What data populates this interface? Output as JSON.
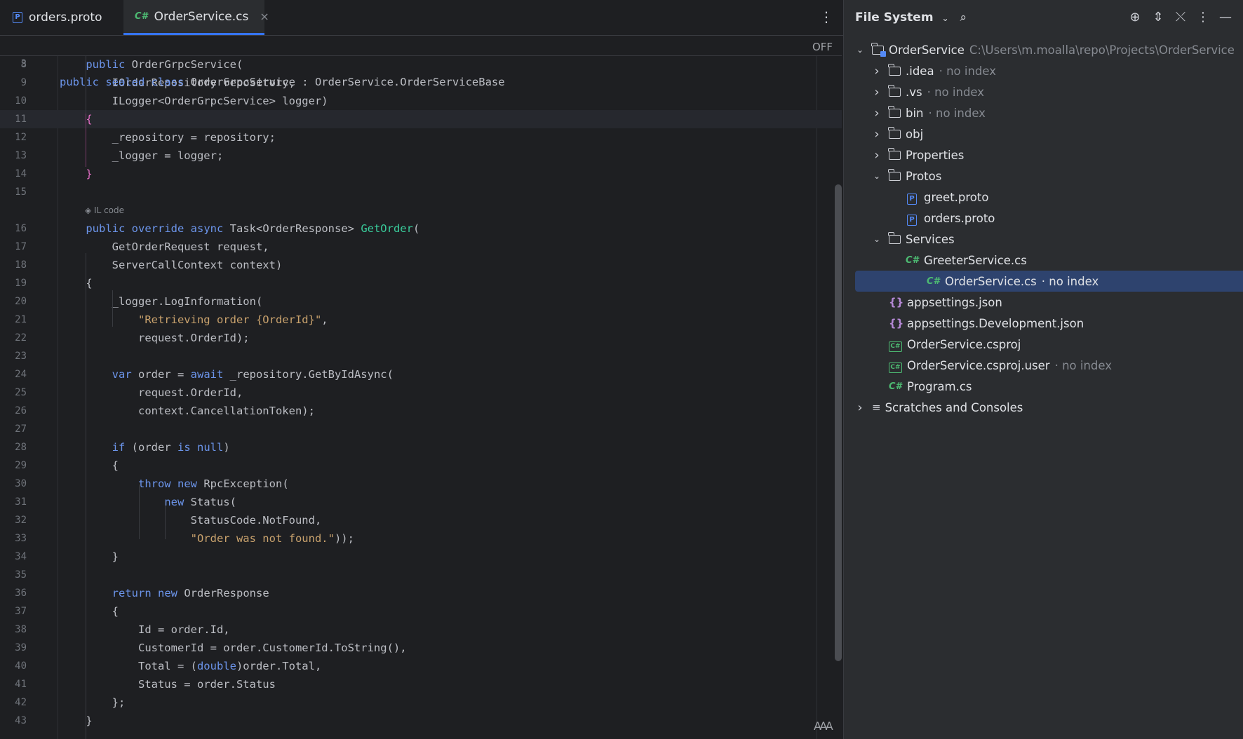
{
  "editor": {
    "tabs": [
      {
        "label": "orders.proto",
        "icon": "proto-file-icon",
        "active": false
      },
      {
        "label": "OrderService.cs",
        "icon": "csharp-file-icon",
        "active": true
      }
    ],
    "close_glyph": "×",
    "sticky_line": {
      "num": "3",
      "text": "public sealed class OrderGrpcService : OrderService.OrderServiceBase"
    },
    "off_label": "OFF",
    "il_hint": "IL code",
    "reader_icon": "AAA",
    "lines": [
      {
        "num": "8",
        "text": "    public OrderGrpcService("
      },
      {
        "num": "9",
        "text": "        IOrderRepository repository,"
      },
      {
        "num": "10",
        "text": "        ILogger<OrderGrpcService> logger)"
      },
      {
        "num": "11",
        "text": "    {"
      },
      {
        "num": "12",
        "text": "        _repository = repository;"
      },
      {
        "num": "13",
        "text": "        _logger = logger;"
      },
      {
        "num": "14",
        "text": "    }"
      },
      {
        "num": "15",
        "text": ""
      },
      {
        "num": "16",
        "text": "    public override async Task<OrderResponse> GetOrder("
      },
      {
        "num": "17",
        "text": "        GetOrderRequest request,"
      },
      {
        "num": "18",
        "text": "        ServerCallContext context)"
      },
      {
        "num": "19",
        "text": "    {"
      },
      {
        "num": "20",
        "text": "        _logger.LogInformation("
      },
      {
        "num": "21",
        "text": "            \"Retrieving order {OrderId}\","
      },
      {
        "num": "22",
        "text": "            request.OrderId);"
      },
      {
        "num": "23",
        "text": ""
      },
      {
        "num": "24",
        "text": "        var order = await _repository.GetByIdAsync("
      },
      {
        "num": "25",
        "text": "            request.OrderId,"
      },
      {
        "num": "26",
        "text": "            context.CancellationToken);"
      },
      {
        "num": "27",
        "text": ""
      },
      {
        "num": "28",
        "text": "        if (order is null)"
      },
      {
        "num": "29",
        "text": "        {"
      },
      {
        "num": "30",
        "text": "            throw new RpcException("
      },
      {
        "num": "31",
        "text": "                new Status("
      },
      {
        "num": "32",
        "text": "                    StatusCode.NotFound,"
      },
      {
        "num": "33",
        "text": "                    \"Order was not found.\"));"
      },
      {
        "num": "34",
        "text": "        }"
      },
      {
        "num": "35",
        "text": ""
      },
      {
        "num": "36",
        "text": "        return new OrderResponse"
      },
      {
        "num": "37",
        "text": "        {"
      },
      {
        "num": "38",
        "text": "            Id = order.Id,"
      },
      {
        "num": "39",
        "text": "            CustomerId = order.CustomerId.ToString(),"
      },
      {
        "num": "40",
        "text": "            Total = (double)order.Total,"
      },
      {
        "num": "41",
        "text": "            Status = order.Status"
      },
      {
        "num": "42",
        "text": "        };"
      },
      {
        "num": "43",
        "text": "    }"
      }
    ]
  },
  "panel": {
    "title": "File System",
    "tree": [
      {
        "label": "OrderService",
        "detail": "C:\\Users\\m.moalla\\repo\\Projects\\OrderService",
        "type": "project",
        "depth": 0,
        "chevron": "down"
      },
      {
        "label": ".idea",
        "detail": "· no index",
        "type": "folder",
        "depth": 1,
        "chevron": "right"
      },
      {
        "label": ".vs",
        "detail": "· no index",
        "type": "folder",
        "depth": 1,
        "chevron": "right"
      },
      {
        "label": "bin",
        "detail": "· no index",
        "type": "folder",
        "depth": 1,
        "chevron": "right"
      },
      {
        "label": "obj",
        "detail": "",
        "type": "folder",
        "depth": 1,
        "chevron": "right"
      },
      {
        "label": "Properties",
        "detail": "",
        "type": "folder",
        "depth": 1,
        "chevron": "right"
      },
      {
        "label": "Protos",
        "detail": "",
        "type": "folder",
        "depth": 1,
        "chevron": "down"
      },
      {
        "label": "greet.proto",
        "detail": "",
        "type": "proto",
        "depth": 2,
        "chevron": ""
      },
      {
        "label": "orders.proto",
        "detail": "",
        "type": "proto",
        "depth": 2,
        "chevron": ""
      },
      {
        "label": "Services",
        "detail": "",
        "type": "folder",
        "depth": 1,
        "chevron": "down"
      },
      {
        "label": "GreeterService.cs",
        "detail": "",
        "type": "cs",
        "depth": 2,
        "chevron": ""
      },
      {
        "label": "OrderService.cs",
        "detail": "· no index",
        "type": "cs",
        "depth": 2,
        "chevron": "",
        "selected": true
      },
      {
        "label": "appsettings.json",
        "detail": "",
        "type": "json",
        "depth": 1,
        "chevron": ""
      },
      {
        "label": "appsettings.Development.json",
        "detail": "",
        "type": "json",
        "depth": 1,
        "chevron": ""
      },
      {
        "label": "OrderService.csproj",
        "detail": "",
        "type": "csproj",
        "depth": 1,
        "chevron": ""
      },
      {
        "label": "OrderService.csproj.user",
        "detail": "· no index",
        "type": "csproj",
        "depth": 1,
        "chevron": ""
      },
      {
        "label": "Program.cs",
        "detail": "",
        "type": "cs",
        "depth": 1,
        "chevron": ""
      },
      {
        "label": "Scratches and Consoles",
        "detail": "",
        "type": "scratch",
        "depth": 0,
        "chevron": "right"
      }
    ]
  }
}
